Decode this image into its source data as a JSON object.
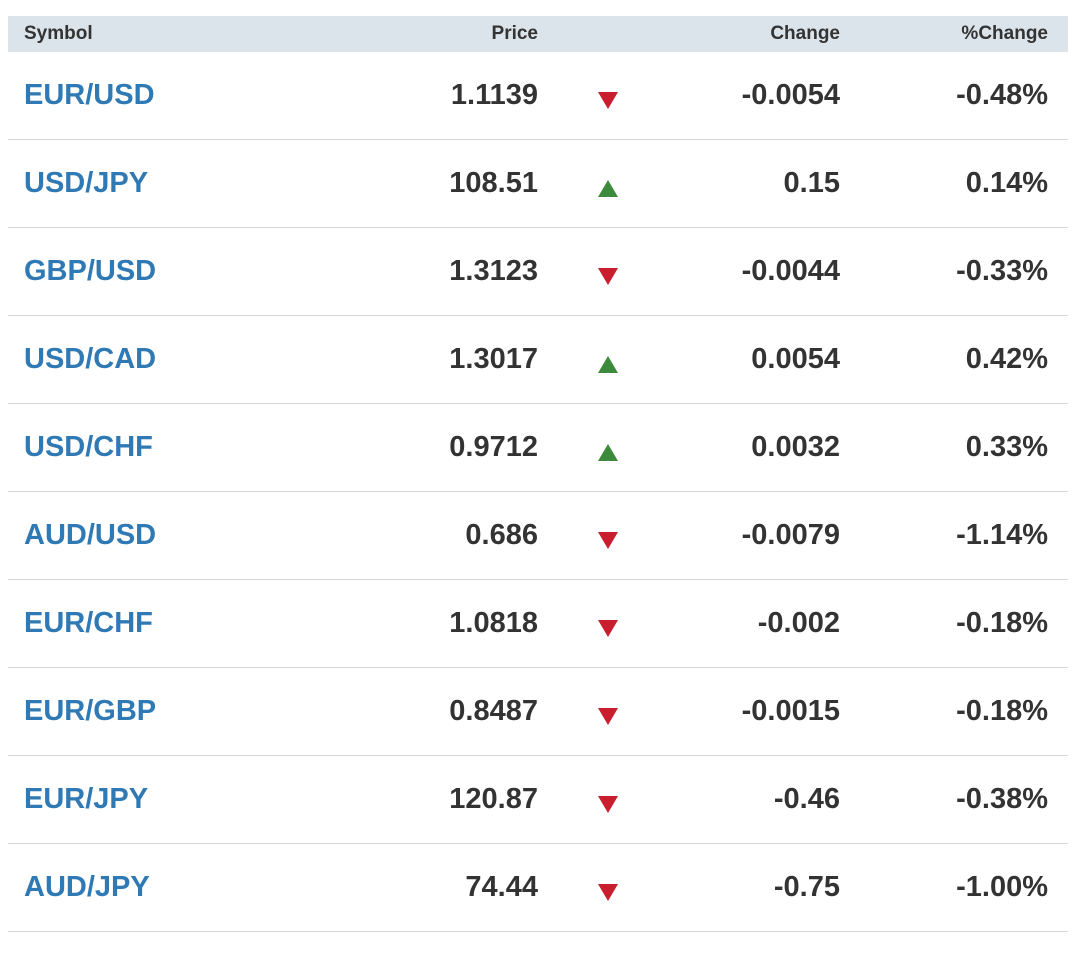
{
  "header": {
    "symbol": "Symbol",
    "price": "Price",
    "change": "Change",
    "pct_change": "%Change"
  },
  "colors": {
    "symbol_link": "#2f79b5",
    "down": "#c81e2d",
    "up": "#3c8a3c",
    "header_bg": "#dce4eb"
  },
  "rows": [
    {
      "symbol": "EUR/USD",
      "price": "1.1139",
      "direction": "down",
      "direction_icon": "triangle-down-icon",
      "change": "-0.0054",
      "pct_change": "-0.48%"
    },
    {
      "symbol": "USD/JPY",
      "price": "108.51",
      "direction": "up",
      "direction_icon": "triangle-up-icon",
      "change": "0.15",
      "pct_change": "0.14%"
    },
    {
      "symbol": "GBP/USD",
      "price": "1.3123",
      "direction": "down",
      "direction_icon": "triangle-down-icon",
      "change": "-0.0044",
      "pct_change": "-0.33%"
    },
    {
      "symbol": "USD/CAD",
      "price": "1.3017",
      "direction": "up",
      "direction_icon": "triangle-up-icon",
      "change": "0.0054",
      "pct_change": "0.42%"
    },
    {
      "symbol": "USD/CHF",
      "price": "0.9712",
      "direction": "up",
      "direction_icon": "triangle-up-icon",
      "change": "0.0032",
      "pct_change": "0.33%"
    },
    {
      "symbol": "AUD/USD",
      "price": "0.686",
      "direction": "down",
      "direction_icon": "triangle-down-icon",
      "change": "-0.0079",
      "pct_change": "-1.14%"
    },
    {
      "symbol": "EUR/CHF",
      "price": "1.0818",
      "direction": "down",
      "direction_icon": "triangle-down-icon",
      "change": "-0.002",
      "pct_change": "-0.18%"
    },
    {
      "symbol": "EUR/GBP",
      "price": "0.8487",
      "direction": "down",
      "direction_icon": "triangle-down-icon",
      "change": "-0.0015",
      "pct_change": "-0.18%"
    },
    {
      "symbol": "EUR/JPY",
      "price": "120.87",
      "direction": "down",
      "direction_icon": "triangle-down-icon",
      "change": "-0.46",
      "pct_change": "-0.38%"
    },
    {
      "symbol": "AUD/JPY",
      "price": "74.44",
      "direction": "down",
      "direction_icon": "triangle-down-icon",
      "change": "-0.75",
      "pct_change": "-1.00%"
    }
  ]
}
